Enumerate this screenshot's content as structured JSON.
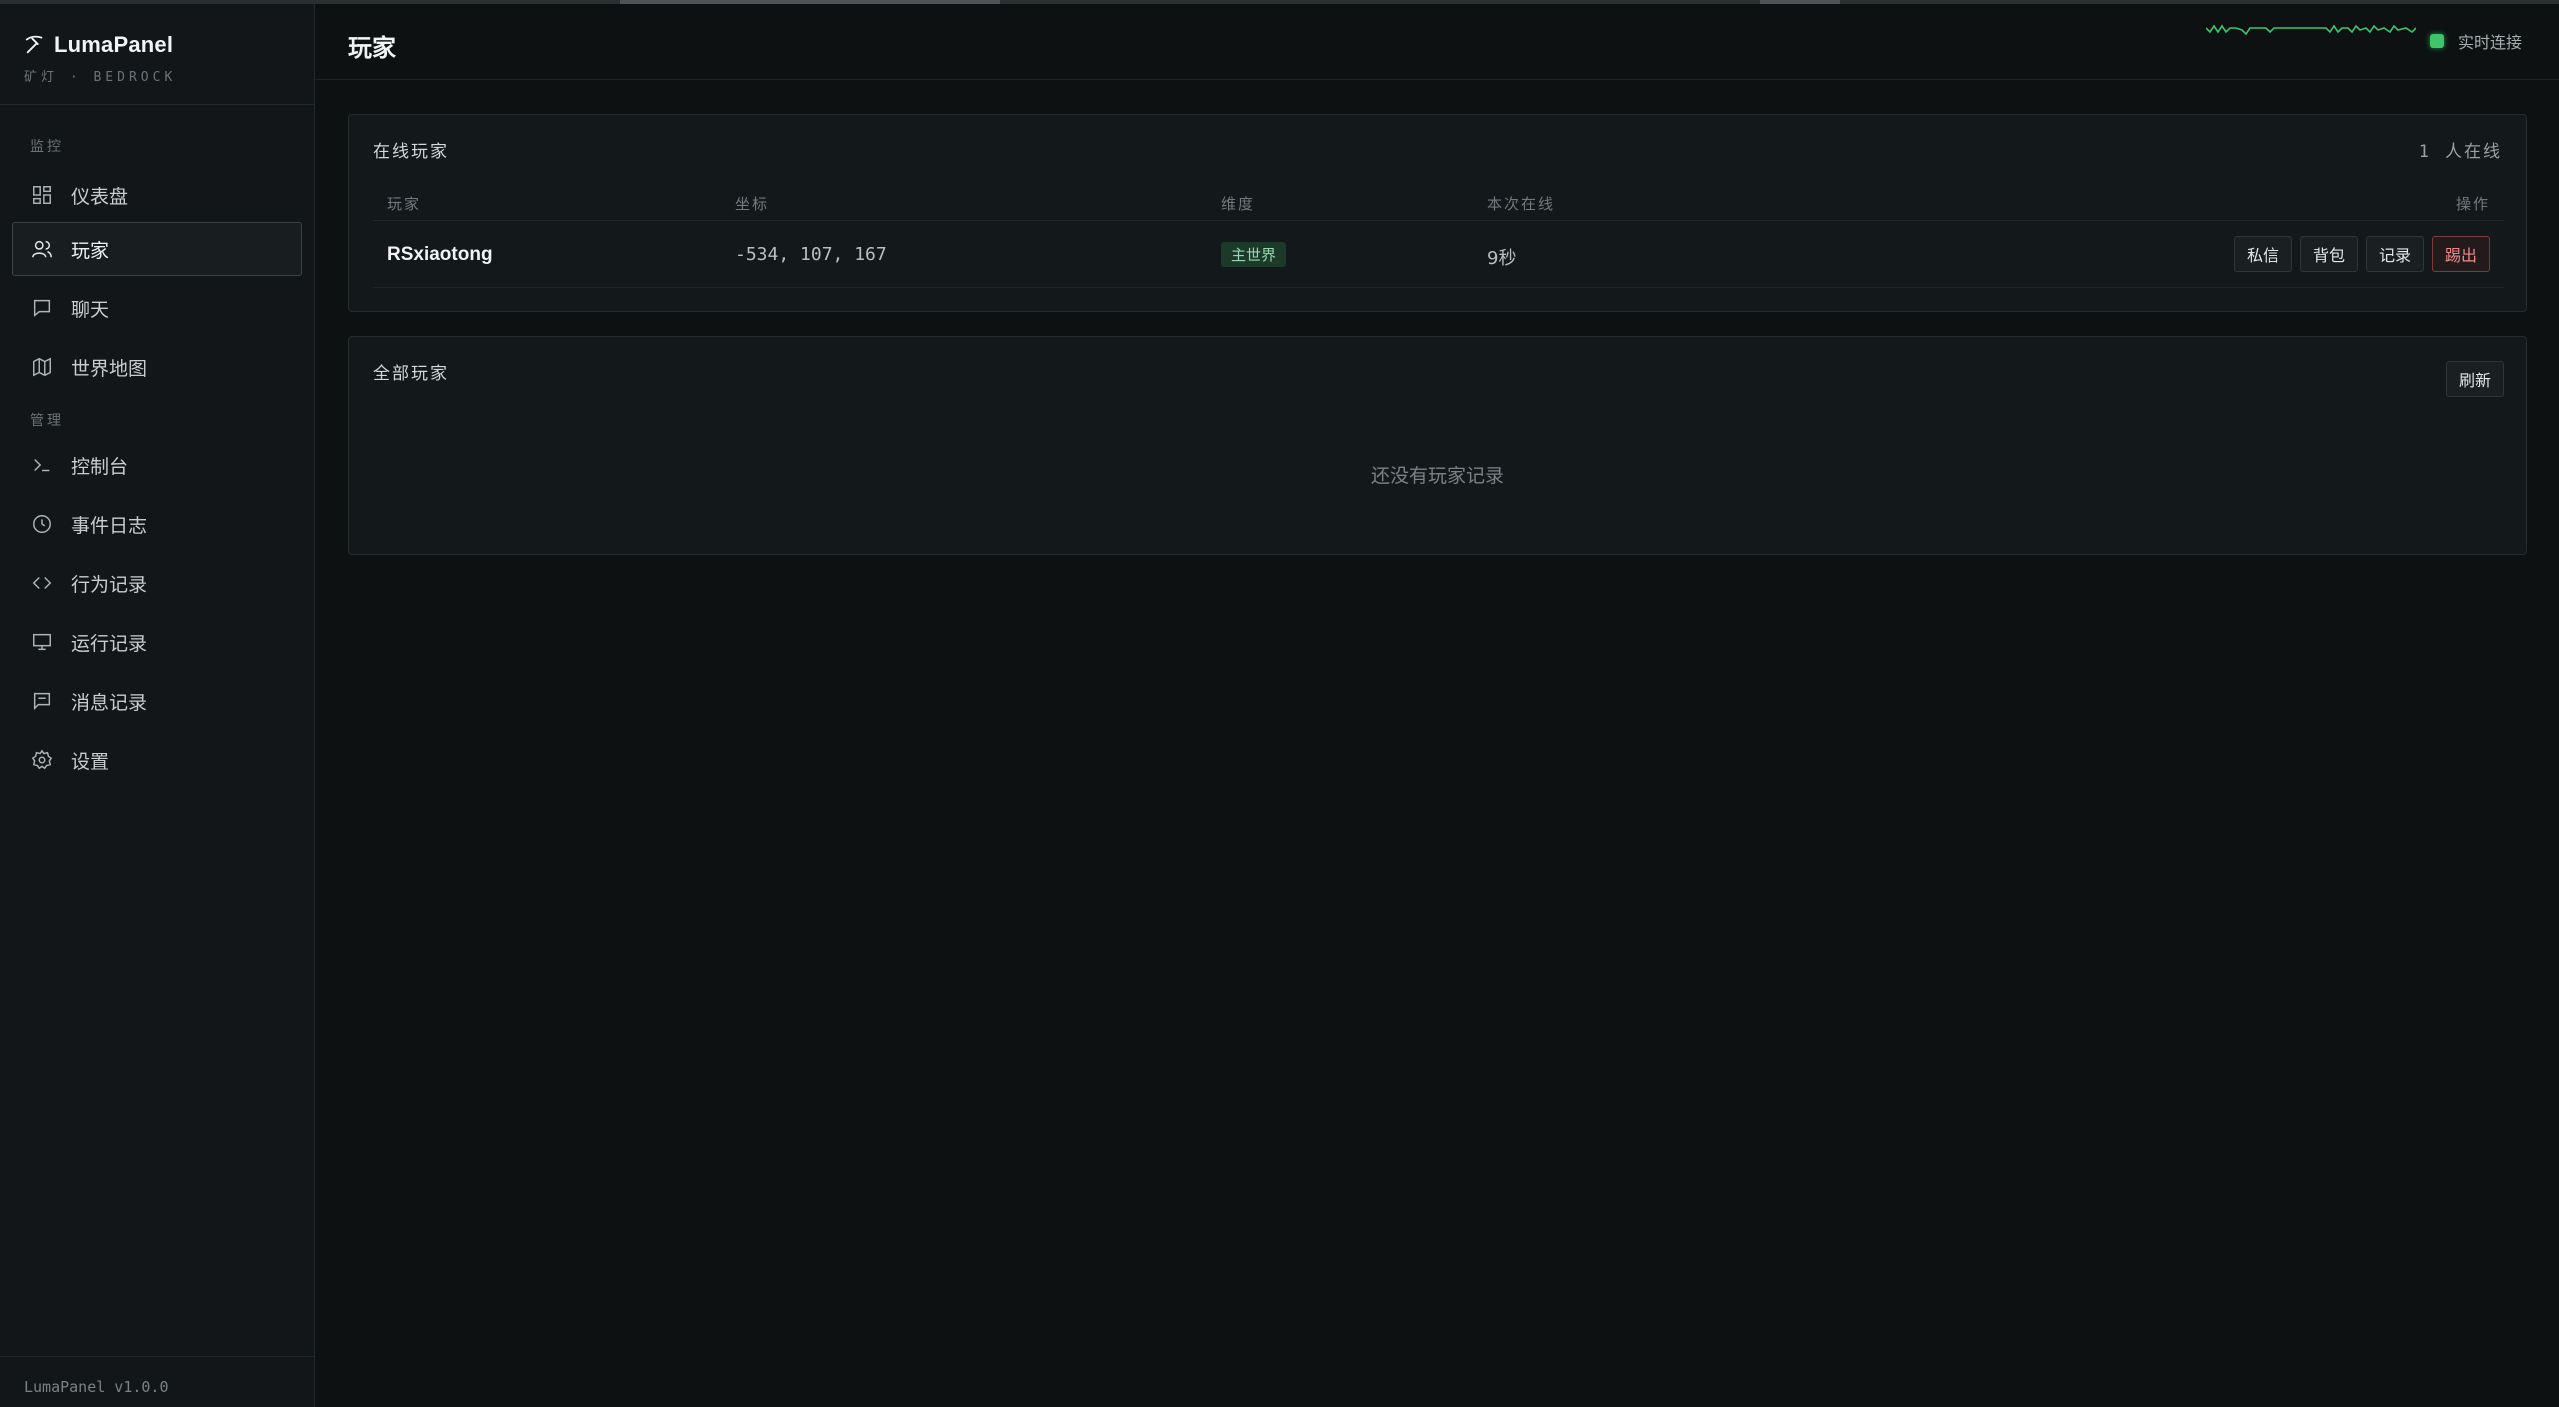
{
  "brand": {
    "name": "LumaPanel",
    "subtitle": "矿灯 · BEDROCK"
  },
  "nav": {
    "sections": [
      {
        "label": "监控",
        "items": [
          {
            "label": "仪表盘",
            "icon": "dashboard-icon"
          },
          {
            "label": "玩家",
            "icon": "users-icon",
            "active": true
          },
          {
            "label": "聊天",
            "icon": "chat-icon"
          },
          {
            "label": "世界地图",
            "icon": "map-icon"
          }
        ]
      },
      {
        "label": "管理",
        "items": [
          {
            "label": "控制台",
            "icon": "terminal-icon"
          },
          {
            "label": "事件日志",
            "icon": "clock-icon"
          },
          {
            "label": "行为记录",
            "icon": "code-icon"
          },
          {
            "label": "运行记录",
            "icon": "monitor-icon"
          },
          {
            "label": "消息记录",
            "icon": "message-icon"
          },
          {
            "label": "设置",
            "icon": "gear-icon"
          }
        ]
      }
    ]
  },
  "version": "LumaPanel v1.0.0",
  "header": {
    "title": "玩家",
    "status_text": "实时连接",
    "status_color": "#3fc46a"
  },
  "online_panel": {
    "title": "在线玩家",
    "count": "1",
    "count_suffix": "人在线",
    "columns": [
      "玩家",
      "坐标",
      "维度",
      "本次在线",
      "操作"
    ],
    "rows": [
      {
        "player": "RSxiaotong",
        "coords": "-534, 107, 167",
        "dimension": "主世界",
        "session": "9秒",
        "actions": [
          "私信",
          "背包",
          "记录",
          "踢出"
        ]
      }
    ]
  },
  "all_panel": {
    "title": "全部玩家",
    "refresh_label": "刷新",
    "empty_text": "还没有玩家记录"
  }
}
